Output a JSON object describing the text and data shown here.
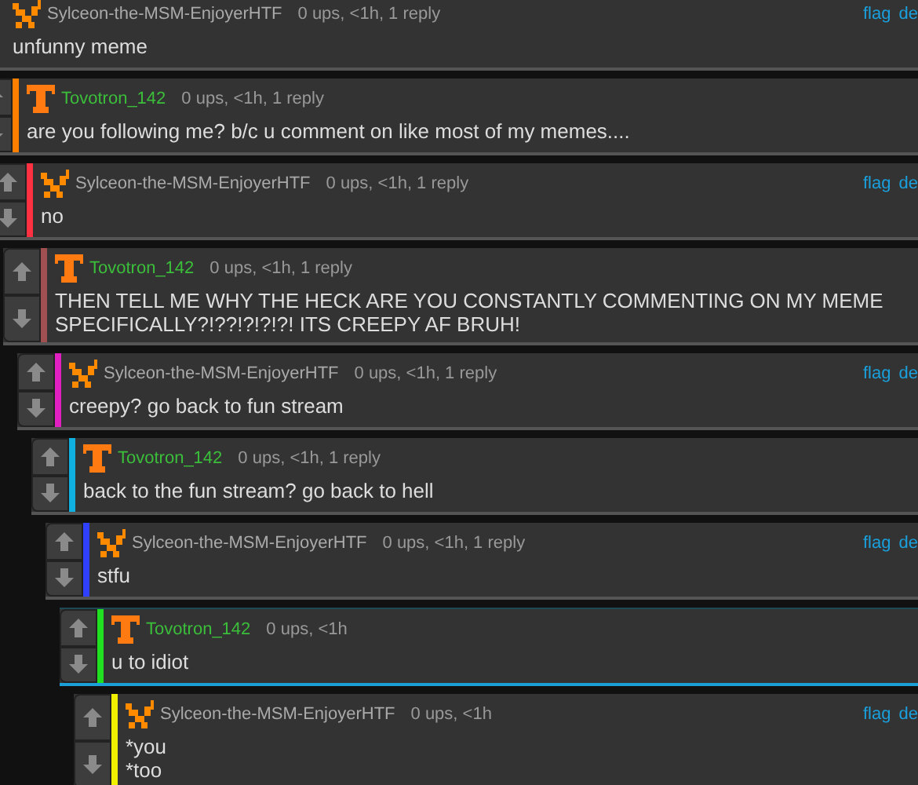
{
  "comments": [
    {
      "kind": "pixel",
      "author": "Sylceon-the-MSM-EnjoyerHTF",
      "op": false,
      "meta": "0 ups, <1h, 1 reply",
      "text": "unfunny meme",
      "votes": false,
      "highlighted": false,
      "links": [
        "flag",
        "de"
      ],
      "replies": [
        {
          "kind": "t",
          "author": "Tovotron_142",
          "op": true,
          "meta": "0 ups, <1h, 1 reply",
          "text": "are you following me? b/c u comment on like most of my memes....",
          "votes": true,
          "color": "#ff8000",
          "highlighted": false,
          "replies": [
            {
              "kind": "pixel",
              "author": "Sylceon-the-MSM-EnjoyerHTF",
              "op": false,
              "meta": "0 ups, <1h, 1 reply",
              "text": "no",
              "votes": true,
              "color": "#ff3040",
              "highlighted": false,
              "links": [
                "flag",
                "de"
              ],
              "replies": [
                {
                  "kind": "t",
                  "author": "Tovotron_142",
                  "op": true,
                  "meta": "0 ups, <1h, 1 reply",
                  "text": "THEN TELL ME WHY THE HECK ARE YOU CONSTANTLY COMMENTING ON MY MEME\nSPECIFICALLY?!??!?!?!?! ITS CREEPY AF BRUH!",
                  "votes": true,
                  "color": "#a05050",
                  "highlighted": false,
                  "replies": [
                    {
                      "kind": "pixel",
                      "author": "Sylceon-the-MSM-EnjoyerHTF",
                      "op": false,
                      "meta": "0 ups, <1h, 1 reply",
                      "text": "creepy? go back to fun stream",
                      "votes": true,
                      "color": "#e020c0",
                      "highlighted": false,
                      "links": [
                        "flag",
                        "de"
                      ],
                      "replies": [
                        {
                          "kind": "t",
                          "author": "Tovotron_142",
                          "op": true,
                          "meta": "0 ups, <1h, 1 reply",
                          "text": "back to the fun stream? go back to hell",
                          "votes": true,
                          "color": "#10b0e0",
                          "highlighted": false,
                          "replies": [
                            {
                              "kind": "pixel",
                              "author": "Sylceon-the-MSM-EnjoyerHTF",
                              "op": false,
                              "meta": "0 ups, <1h, 1 reply",
                              "text": "stfu",
                              "votes": true,
                              "color": "#3040ff",
                              "highlighted": false,
                              "links": [
                                "flag",
                                "de"
                              ],
                              "replies": [
                                {
                                  "kind": "t",
                                  "author": "Tovotron_142",
                                  "op": true,
                                  "meta": "0 ups, <1h",
                                  "text": "u to idiot",
                                  "votes": true,
                                  "color": "#20e020",
                                  "highlighted": true,
                                  "replies": [
                                    {
                                      "kind": "pixel",
                                      "author": "Sylceon-the-MSM-EnjoyerHTF",
                                      "op": false,
                                      "meta": "0 ups, <1h",
                                      "text": "*you\n*too",
                                      "votes": true,
                                      "color": "#f0f000",
                                      "highlighted": false,
                                      "links": [
                                        "flag",
                                        "de"
                                      ]
                                    }
                                  ]
                                }
                              ]
                            }
                          ]
                        }
                      ]
                    }
                  ]
                }
              ]
            }
          ]
        }
      ]
    }
  ]
}
